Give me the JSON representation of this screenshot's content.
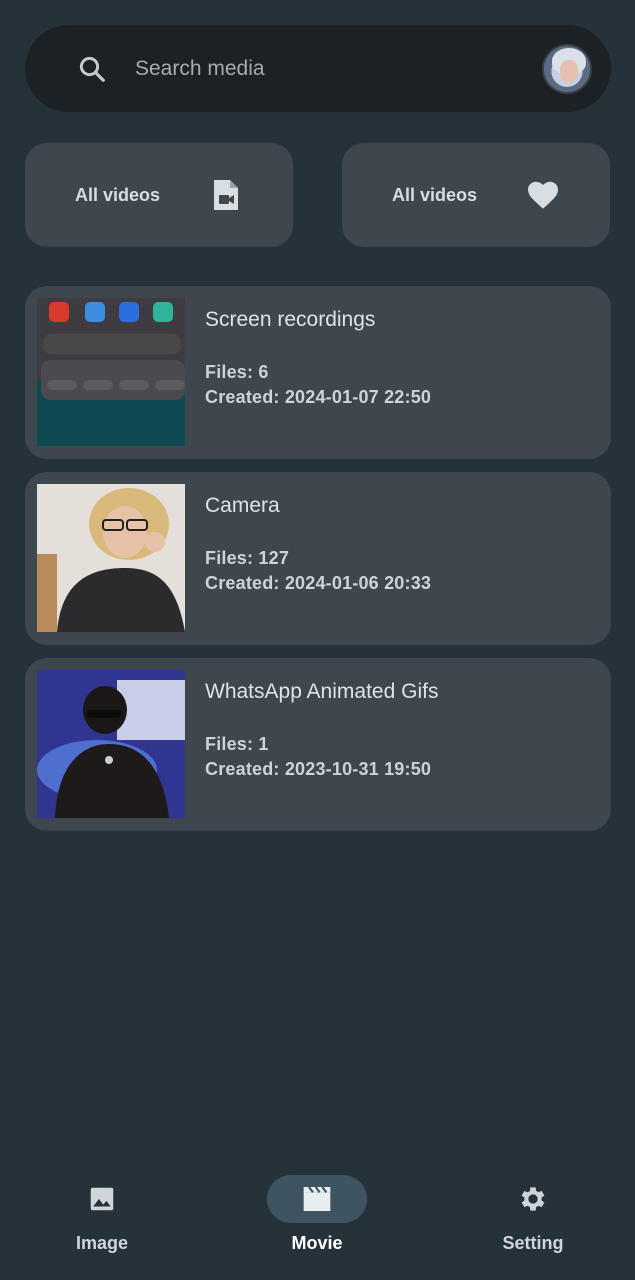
{
  "search": {
    "placeholder": "Search media",
    "icon": "search-icon"
  },
  "profile": {
    "icon": "avatar"
  },
  "quick_actions": [
    {
      "label": "All videos",
      "icon": "video-file-icon"
    },
    {
      "label": "All videos",
      "icon": "heart-icon"
    }
  ],
  "albums": [
    {
      "title": "Screen recordings",
      "files": "Files: 6",
      "created": "Created: 2024-01-07 22:50"
    },
    {
      "title": "Camera",
      "files": "Files: 127",
      "created": "Created: 2024-01-06 20:33"
    },
    {
      "title": "WhatsApp Animated Gifs",
      "files": "Files: 1",
      "created": "Created: 2023-10-31 19:50"
    }
  ],
  "nav": {
    "items": [
      {
        "label": "Image",
        "icon": "image-icon"
      },
      {
        "label": "Movie",
        "icon": "movie-icon"
      },
      {
        "label": "Setting",
        "icon": "gear-icon"
      }
    ],
    "active": "Movie"
  },
  "colors": {
    "background": "#263239",
    "card": "#3f474e",
    "search_bg": "#1b2125",
    "active_pill": "#3f5461"
  }
}
